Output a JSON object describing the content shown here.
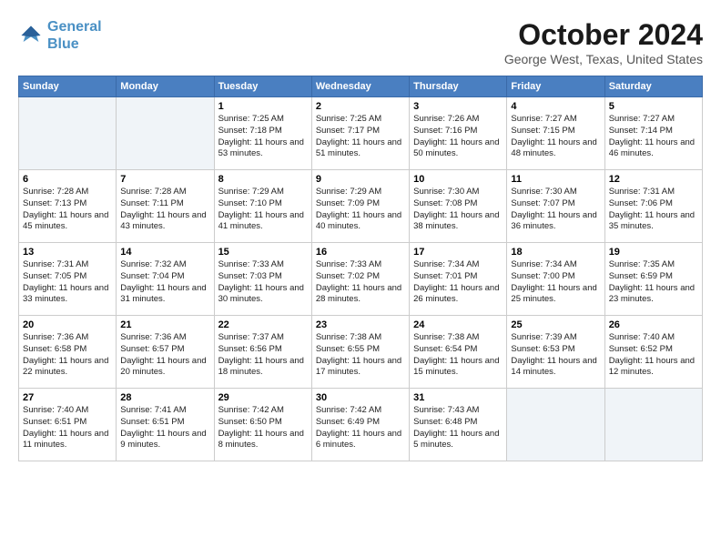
{
  "header": {
    "logo_line1": "General",
    "logo_line2": "Blue",
    "month": "October 2024",
    "location": "George West, Texas, United States"
  },
  "weekdays": [
    "Sunday",
    "Monday",
    "Tuesday",
    "Wednesday",
    "Thursday",
    "Friday",
    "Saturday"
  ],
  "weeks": [
    [
      {
        "day": "",
        "info": ""
      },
      {
        "day": "",
        "info": ""
      },
      {
        "day": "1",
        "info": "Sunrise: 7:25 AM\nSunset: 7:18 PM\nDaylight: 11 hours and 53 minutes."
      },
      {
        "day": "2",
        "info": "Sunrise: 7:25 AM\nSunset: 7:17 PM\nDaylight: 11 hours and 51 minutes."
      },
      {
        "day": "3",
        "info": "Sunrise: 7:26 AM\nSunset: 7:16 PM\nDaylight: 11 hours and 50 minutes."
      },
      {
        "day": "4",
        "info": "Sunrise: 7:27 AM\nSunset: 7:15 PM\nDaylight: 11 hours and 48 minutes."
      },
      {
        "day": "5",
        "info": "Sunrise: 7:27 AM\nSunset: 7:14 PM\nDaylight: 11 hours and 46 minutes."
      }
    ],
    [
      {
        "day": "6",
        "info": "Sunrise: 7:28 AM\nSunset: 7:13 PM\nDaylight: 11 hours and 45 minutes."
      },
      {
        "day": "7",
        "info": "Sunrise: 7:28 AM\nSunset: 7:11 PM\nDaylight: 11 hours and 43 minutes."
      },
      {
        "day": "8",
        "info": "Sunrise: 7:29 AM\nSunset: 7:10 PM\nDaylight: 11 hours and 41 minutes."
      },
      {
        "day": "9",
        "info": "Sunrise: 7:29 AM\nSunset: 7:09 PM\nDaylight: 11 hours and 40 minutes."
      },
      {
        "day": "10",
        "info": "Sunrise: 7:30 AM\nSunset: 7:08 PM\nDaylight: 11 hours and 38 minutes."
      },
      {
        "day": "11",
        "info": "Sunrise: 7:30 AM\nSunset: 7:07 PM\nDaylight: 11 hours and 36 minutes."
      },
      {
        "day": "12",
        "info": "Sunrise: 7:31 AM\nSunset: 7:06 PM\nDaylight: 11 hours and 35 minutes."
      }
    ],
    [
      {
        "day": "13",
        "info": "Sunrise: 7:31 AM\nSunset: 7:05 PM\nDaylight: 11 hours and 33 minutes."
      },
      {
        "day": "14",
        "info": "Sunrise: 7:32 AM\nSunset: 7:04 PM\nDaylight: 11 hours and 31 minutes."
      },
      {
        "day": "15",
        "info": "Sunrise: 7:33 AM\nSunset: 7:03 PM\nDaylight: 11 hours and 30 minutes."
      },
      {
        "day": "16",
        "info": "Sunrise: 7:33 AM\nSunset: 7:02 PM\nDaylight: 11 hours and 28 minutes."
      },
      {
        "day": "17",
        "info": "Sunrise: 7:34 AM\nSunset: 7:01 PM\nDaylight: 11 hours and 26 minutes."
      },
      {
        "day": "18",
        "info": "Sunrise: 7:34 AM\nSunset: 7:00 PM\nDaylight: 11 hours and 25 minutes."
      },
      {
        "day": "19",
        "info": "Sunrise: 7:35 AM\nSunset: 6:59 PM\nDaylight: 11 hours and 23 minutes."
      }
    ],
    [
      {
        "day": "20",
        "info": "Sunrise: 7:36 AM\nSunset: 6:58 PM\nDaylight: 11 hours and 22 minutes."
      },
      {
        "day": "21",
        "info": "Sunrise: 7:36 AM\nSunset: 6:57 PM\nDaylight: 11 hours and 20 minutes."
      },
      {
        "day": "22",
        "info": "Sunrise: 7:37 AM\nSunset: 6:56 PM\nDaylight: 11 hours and 18 minutes."
      },
      {
        "day": "23",
        "info": "Sunrise: 7:38 AM\nSunset: 6:55 PM\nDaylight: 11 hours and 17 minutes."
      },
      {
        "day": "24",
        "info": "Sunrise: 7:38 AM\nSunset: 6:54 PM\nDaylight: 11 hours and 15 minutes."
      },
      {
        "day": "25",
        "info": "Sunrise: 7:39 AM\nSunset: 6:53 PM\nDaylight: 11 hours and 14 minutes."
      },
      {
        "day": "26",
        "info": "Sunrise: 7:40 AM\nSunset: 6:52 PM\nDaylight: 11 hours and 12 minutes."
      }
    ],
    [
      {
        "day": "27",
        "info": "Sunrise: 7:40 AM\nSunset: 6:51 PM\nDaylight: 11 hours and 11 minutes."
      },
      {
        "day": "28",
        "info": "Sunrise: 7:41 AM\nSunset: 6:51 PM\nDaylight: 11 hours and 9 minutes."
      },
      {
        "day": "29",
        "info": "Sunrise: 7:42 AM\nSunset: 6:50 PM\nDaylight: 11 hours and 8 minutes."
      },
      {
        "day": "30",
        "info": "Sunrise: 7:42 AM\nSunset: 6:49 PM\nDaylight: 11 hours and 6 minutes."
      },
      {
        "day": "31",
        "info": "Sunrise: 7:43 AM\nSunset: 6:48 PM\nDaylight: 11 hours and 5 minutes."
      },
      {
        "day": "",
        "info": ""
      },
      {
        "day": "",
        "info": ""
      }
    ]
  ]
}
